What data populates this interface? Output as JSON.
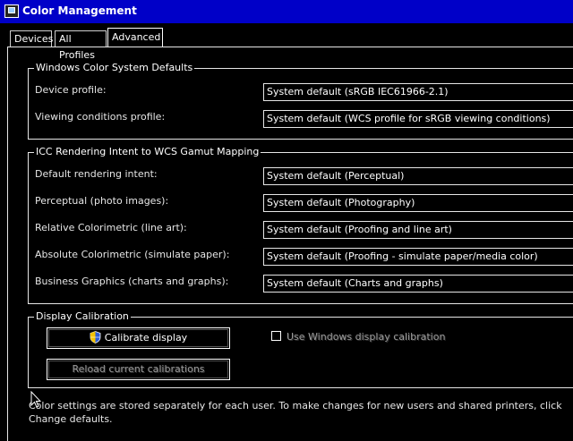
{
  "window": {
    "title": "Color Management"
  },
  "tabs": [
    {
      "label": "Devices"
    },
    {
      "label": "All Profiles"
    },
    {
      "label": "Advanced"
    }
  ],
  "wcs_defaults": {
    "legend": "Windows Color System Defaults",
    "rows": [
      {
        "label": "Device profile:",
        "value": "System default (sRGB IEC61966-2.1)"
      },
      {
        "label": "Viewing conditions profile:",
        "value": "System default (WCS profile for sRGB viewing conditions)"
      }
    ]
  },
  "icc_mapping": {
    "legend": "ICC Rendering Intent to WCS Gamut Mapping",
    "rows": [
      {
        "label": "Default rendering intent:",
        "value": "System default (Perceptual)"
      },
      {
        "label": "Perceptual (photo images):",
        "value": "System default (Photography)"
      },
      {
        "label": "Relative Colorimetric (line art):",
        "value": "System default (Proofing and line art)"
      },
      {
        "label": "Absolute Colorimetric (simulate paper):",
        "value": "System default (Proofing - simulate paper/media color)"
      },
      {
        "label": "Business Graphics (charts and graphs):",
        "value": "System default (Charts and graphs)"
      }
    ]
  },
  "calibration": {
    "legend": "Display Calibration",
    "calibrate_button": "Calibrate display",
    "reload_button": "Reload current calibrations",
    "use_windows_calibration": {
      "label": "Use Windows display calibration",
      "checked": false
    }
  },
  "footer": {
    "text": "Color settings are stored separately for each user. To make changes for new users and shared printers, click Change defaults."
  },
  "colors": {
    "titlebar": "#0000c8",
    "background": "#000000",
    "text": "#e6e6e6"
  },
  "icons": [
    "app-icon",
    "shield-icon",
    "mouse-cursor-icon"
  ]
}
